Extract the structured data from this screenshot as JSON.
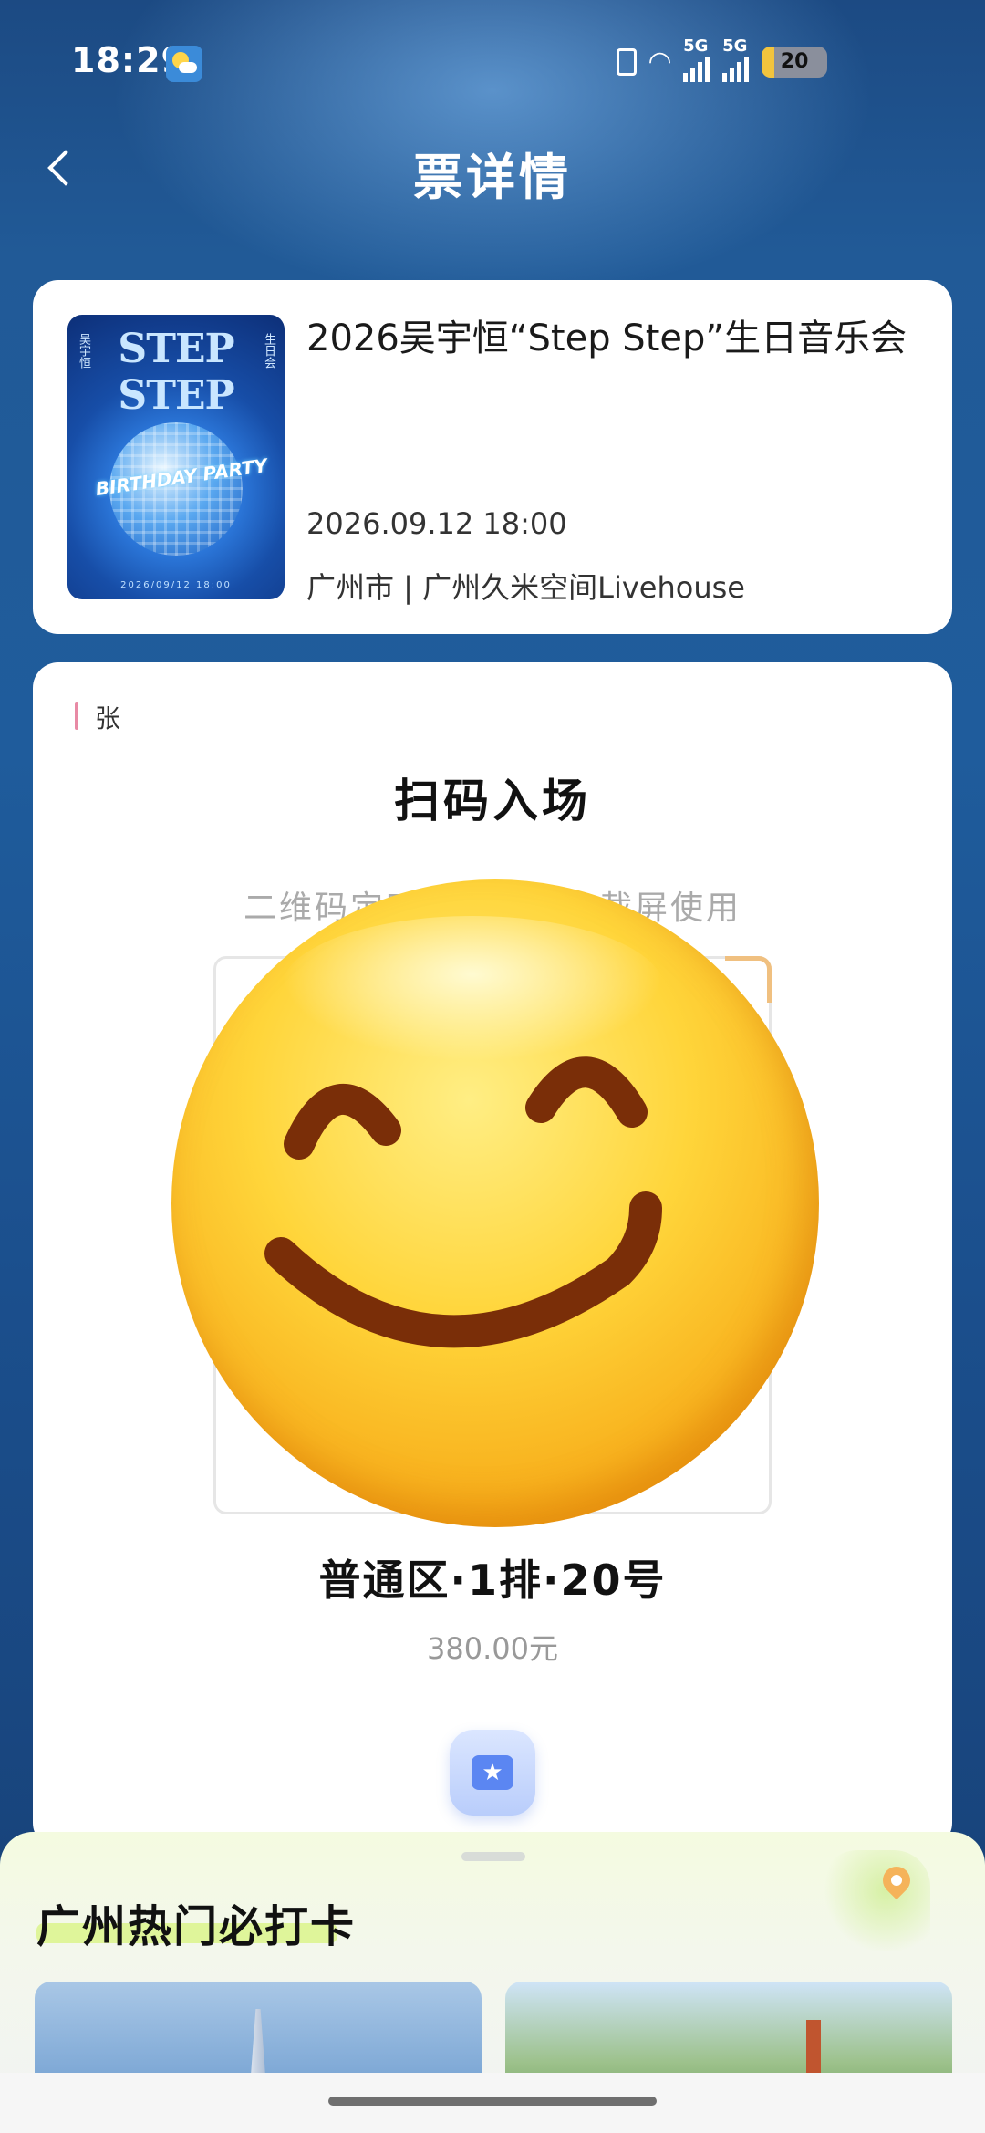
{
  "status_bar": {
    "time": "18:29",
    "network_1": "5G",
    "network_2": "5G",
    "battery": "20",
    "battery_level_fraction": 0.2
  },
  "header": {
    "title": "票详情"
  },
  "event": {
    "name": "2026吴宇恒“Step Step”生日音乐会",
    "datetime": "2026.09.12 18:00",
    "venue": "广州市 | 广州久米空间Livehouse",
    "poster": {
      "title": "STEP STEP",
      "side_left": "吴宇恒",
      "side_right": "生日会",
      "banner": "BIRTHDAY PARTY",
      "date": "2026/09/12 18:00"
    }
  },
  "ticket": {
    "holder": "张",
    "scan_title": "扫码入场",
    "scan_tip": "二维码定时刷新，请勿截屏使用",
    "seat": "普通区·1排·20号",
    "price": "380.00元"
  },
  "recommend": {
    "title": "广州热门必打卡"
  },
  "colors": {
    "background_top": "#1c4a83",
    "accent_pink": "#e88aa5",
    "accent_blue": "#5b86f2",
    "highlight_green": "#dff59a"
  }
}
